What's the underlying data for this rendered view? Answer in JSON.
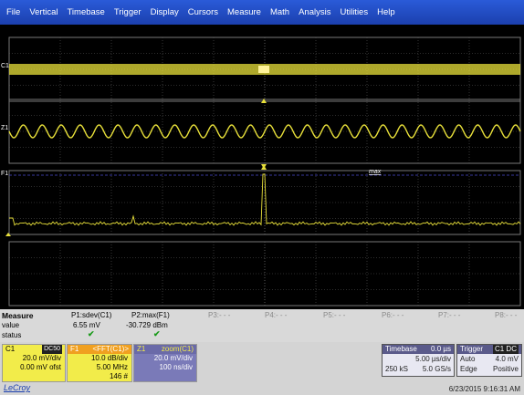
{
  "menu": [
    "File",
    "Vertical",
    "Timebase",
    "Trigger",
    "Display",
    "Cursors",
    "Measure",
    "Math",
    "Analysis",
    "Utilities",
    "Help"
  ],
  "traces": {
    "c1_label": "C1",
    "z1_label": "Z1",
    "f1_label": "F1",
    "max_marker": "max",
    "colors": {
      "yellow": "#e8e03a",
      "grid": "#5a5a5a",
      "dashed": "#3a3aa0"
    }
  },
  "measure": {
    "title": "Measure",
    "row_value": "value",
    "row_status": "status",
    "p1_name": "P1:sdev(C1)",
    "p1_value": "6.55 mV",
    "p2_name": "P2:max(F1)",
    "p2_value": "-30.729 dBm",
    "status_mark": "✔",
    "empty": [
      "P3:- - -",
      "P4:- - -",
      "P5:- - -",
      "P6:- - -",
      "P7:- - -",
      "P8:- - -"
    ]
  },
  "descriptors": {
    "c1": {
      "name": "C1",
      "badge": "DC50",
      "r1": "20.0 mV/div",
      "r2": "0.00 mV ofst"
    },
    "f1": {
      "name": "F1",
      "func": "<FFT(C1)>",
      "r1": "10.0 dB/div",
      "r2": "5.00 MHz",
      "r3": "146 #"
    },
    "z1": {
      "name": "Z1",
      "func": "zoom(C1)",
      "r1": "20.0 mV/div",
      "r2": "100 ns/div"
    }
  },
  "brand": "LeCroy",
  "timebase": {
    "title": "Timebase",
    "delay": "0.0 µs",
    "r1a": "5.00 µs/div",
    "r2a": "250 kS",
    "r2b": "5.0 GS/s"
  },
  "trigger": {
    "title": "Trigger",
    "badge": "C1 DC",
    "r1a": "Auto",
    "r1b": "4.0 mV",
    "r2a": "Edge",
    "r2b": "Positive"
  },
  "timestamp": "6/23/2015 9:16:31 AM"
}
